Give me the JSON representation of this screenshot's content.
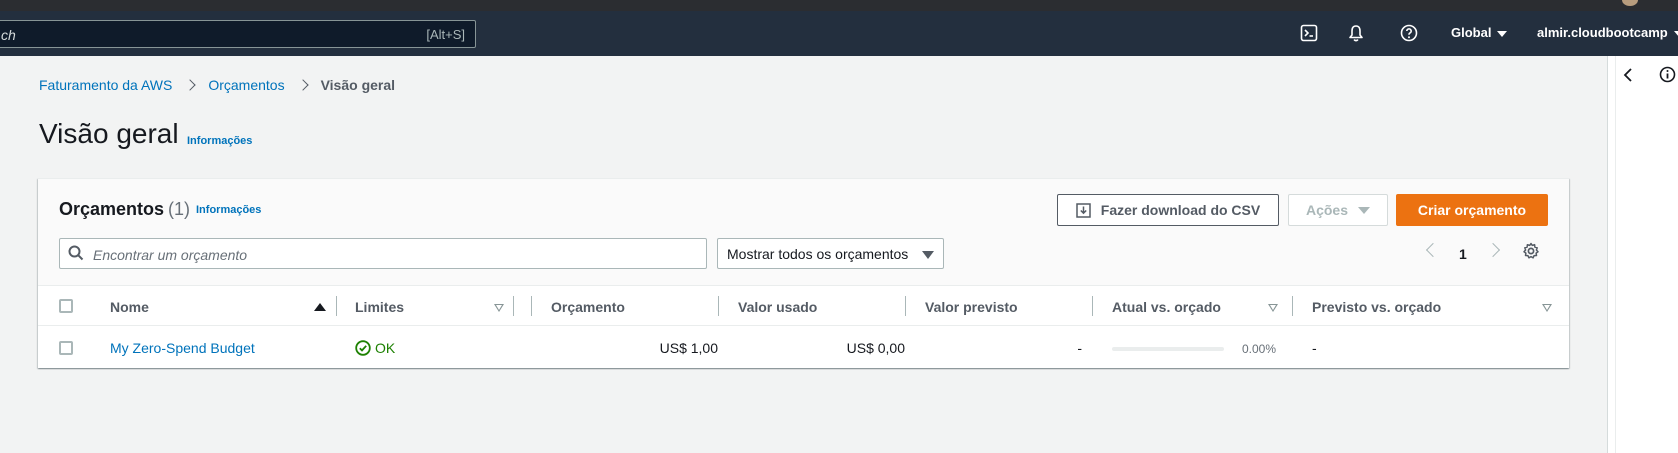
{
  "topnav": {
    "search_placeholder": "ch",
    "search_shortcut": "[Alt+S]",
    "region_label": "Global",
    "account_label": "almir.cloudbootcamp"
  },
  "breadcrumb": {
    "items": [
      "Faturamento da AWS",
      "Orçamentos"
    ],
    "current": "Visão geral"
  },
  "page": {
    "title": "Visão geral",
    "info_label": "Informações"
  },
  "budgets": {
    "title": "Orçamentos",
    "count": "(1)",
    "info_label": "Informações",
    "download_label": "Fazer download do CSV",
    "actions_label": "Ações",
    "create_label": "Criar orçamento",
    "search_placeholder": "Encontrar um orçamento",
    "filter_selected": "Mostrar todos os orçamentos",
    "page_number": "1",
    "columns": [
      "Nome",
      "Limites",
      "Orçamento",
      "Valor usado",
      "Valor previsto",
      "Atual vs. orçado",
      "Previsto vs. orçado"
    ],
    "rows": [
      {
        "name": "My Zero-Spend Budget",
        "limits": "OK",
        "budget": "US$ 1,00",
        "used": "US$ 0,00",
        "forecast": "-",
        "actual_vs_budget_pct": "0.00%",
        "actual_vs_budget_fraction": 0,
        "forecast_vs_budget": "-"
      }
    ]
  },
  "colors": {
    "nav_bg": "#232f3e",
    "primary": "#ec7211",
    "link": "#0073bb",
    "success": "#1d8102"
  }
}
